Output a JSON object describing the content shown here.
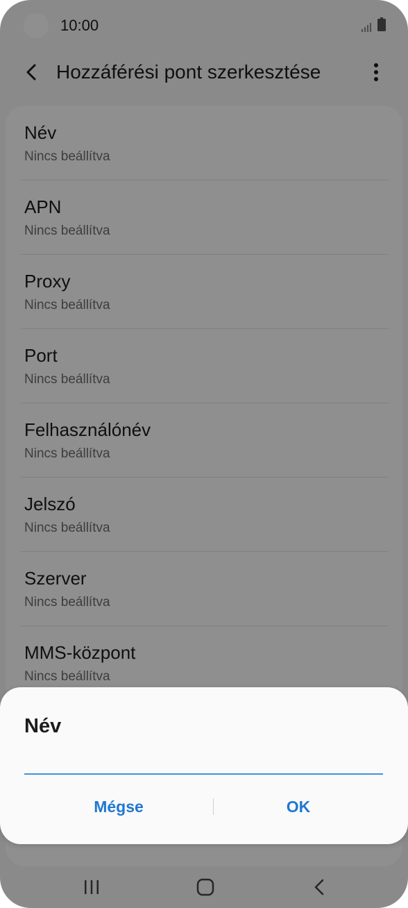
{
  "status_bar": {
    "time": "10:00"
  },
  "app_bar": {
    "title": "Hozzáférési pont szerkesztése",
    "back_icon": "chevron-left-icon",
    "more_icon": "more-vertical-icon"
  },
  "settings": [
    {
      "title": "Név",
      "value": "Nincs beállítva"
    },
    {
      "title": "APN",
      "value": "Nincs beállítva"
    },
    {
      "title": "Proxy",
      "value": "Nincs beállítva"
    },
    {
      "title": "Port",
      "value": "Nincs beállítva"
    },
    {
      "title": "Felhasználónév",
      "value": "Nincs beállítva"
    },
    {
      "title": "Jelszó",
      "value": "Nincs beállítva"
    },
    {
      "title": "Szerver",
      "value": "Nincs beállítva"
    },
    {
      "title": "MMS-központ",
      "value": "Nincs beállítva"
    }
  ],
  "dialog": {
    "title": "Név",
    "input_value": "",
    "cancel_label": "Mégse",
    "ok_label": "OK"
  },
  "nav_bar": {
    "recents_icon": "recents-icon",
    "home_icon": "home-icon",
    "back_icon": "back-icon"
  },
  "colors": {
    "accent": "#1f78d1",
    "input_underline": "#3e91de",
    "scrim": "rgba(0,0,0,0.44)"
  }
}
